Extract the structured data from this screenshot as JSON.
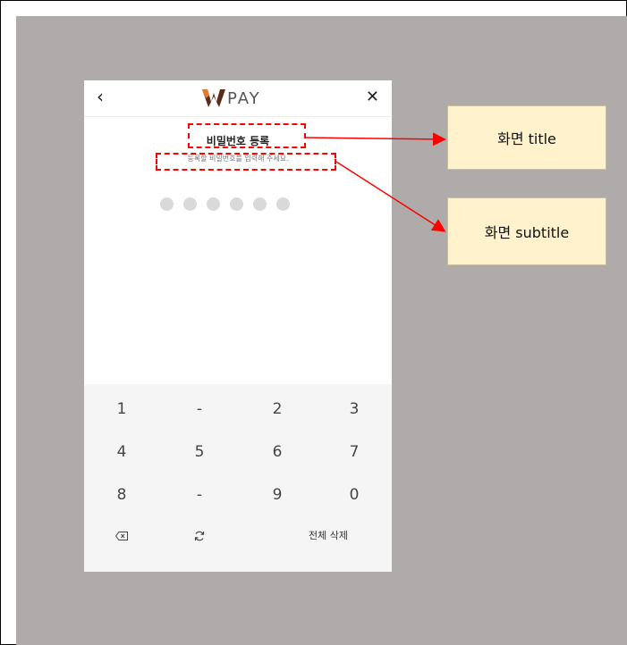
{
  "app": {
    "logo_text": "PAY",
    "back_icon": "chevron-left",
    "close_icon": "close"
  },
  "screen": {
    "title": "비밀번호 등록",
    "subtitle": "등록할 비밀번호를 입력해 주세요.",
    "pin_length": 6,
    "pin_filled": 0
  },
  "keypad": {
    "rows": [
      [
        "1",
        "-",
        "2",
        "3"
      ],
      [
        "4",
        "5",
        "6",
        "7"
      ],
      [
        "8",
        "-",
        "9",
        "0"
      ]
    ],
    "backspace_icon": "backspace",
    "shuffle_icon": "refresh",
    "clear_all_label": "전체 삭제"
  },
  "annotations": {
    "title_callout": "화면 title",
    "subtitle_callout": "화면 subtitle",
    "highlight_color": "#ff0000",
    "callout_color": "#fff2cc",
    "background_color": "#afabab"
  }
}
